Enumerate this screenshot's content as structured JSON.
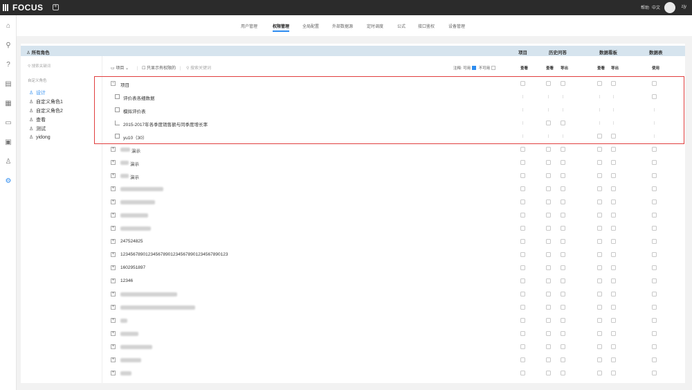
{
  "app": {
    "logo": "FOCUS",
    "help": "帮助",
    "language": "中文",
    "username": "zjy"
  },
  "tabs": [
    "用户管理",
    "权限管理",
    "全局配置",
    "外部数据源",
    "定时调度",
    "公式",
    "接口鉴权",
    "设备管理"
  ],
  "active_tab": "权限管理",
  "sidebar": {
    "header": "所有角色",
    "search_placeholder": "搜索关键词",
    "group_label": "自定义角色",
    "roles": [
      "设计",
      "自定义角色1",
      "自定义角色2",
      "查看",
      "测试",
      "yidong"
    ],
    "selected": "设计"
  },
  "columns": {
    "project": "项目",
    "history": "历史问答",
    "dashboard": "数据看板",
    "datatable": "数据表",
    "view1": "查看",
    "view2": "查看",
    "export1": "导出",
    "view3": "查看",
    "export2": "导出",
    "use": "使用"
  },
  "toolbar": {
    "project_dropdown": "项目",
    "only_show_label": "只显示有权限的",
    "search_placeholder": "搜索关键词",
    "legend_prefix": "注释:",
    "legend_allowed": "可用",
    "legend_disabled": "不可用",
    "allowed_color": "#2d8cf0"
  },
  "tree": {
    "root": "项目",
    "children": [
      "评价表各细数据",
      "模拟评价表",
      "2015-2017年各季度销售额与同季度增长率",
      "yu10（30）"
    ]
  },
  "projects": [
    "演示",
    "演示",
    "演示",
    "247524825",
    "1234567890123456789012345678901234567890123",
    "1602951897",
    "12346"
  ]
}
